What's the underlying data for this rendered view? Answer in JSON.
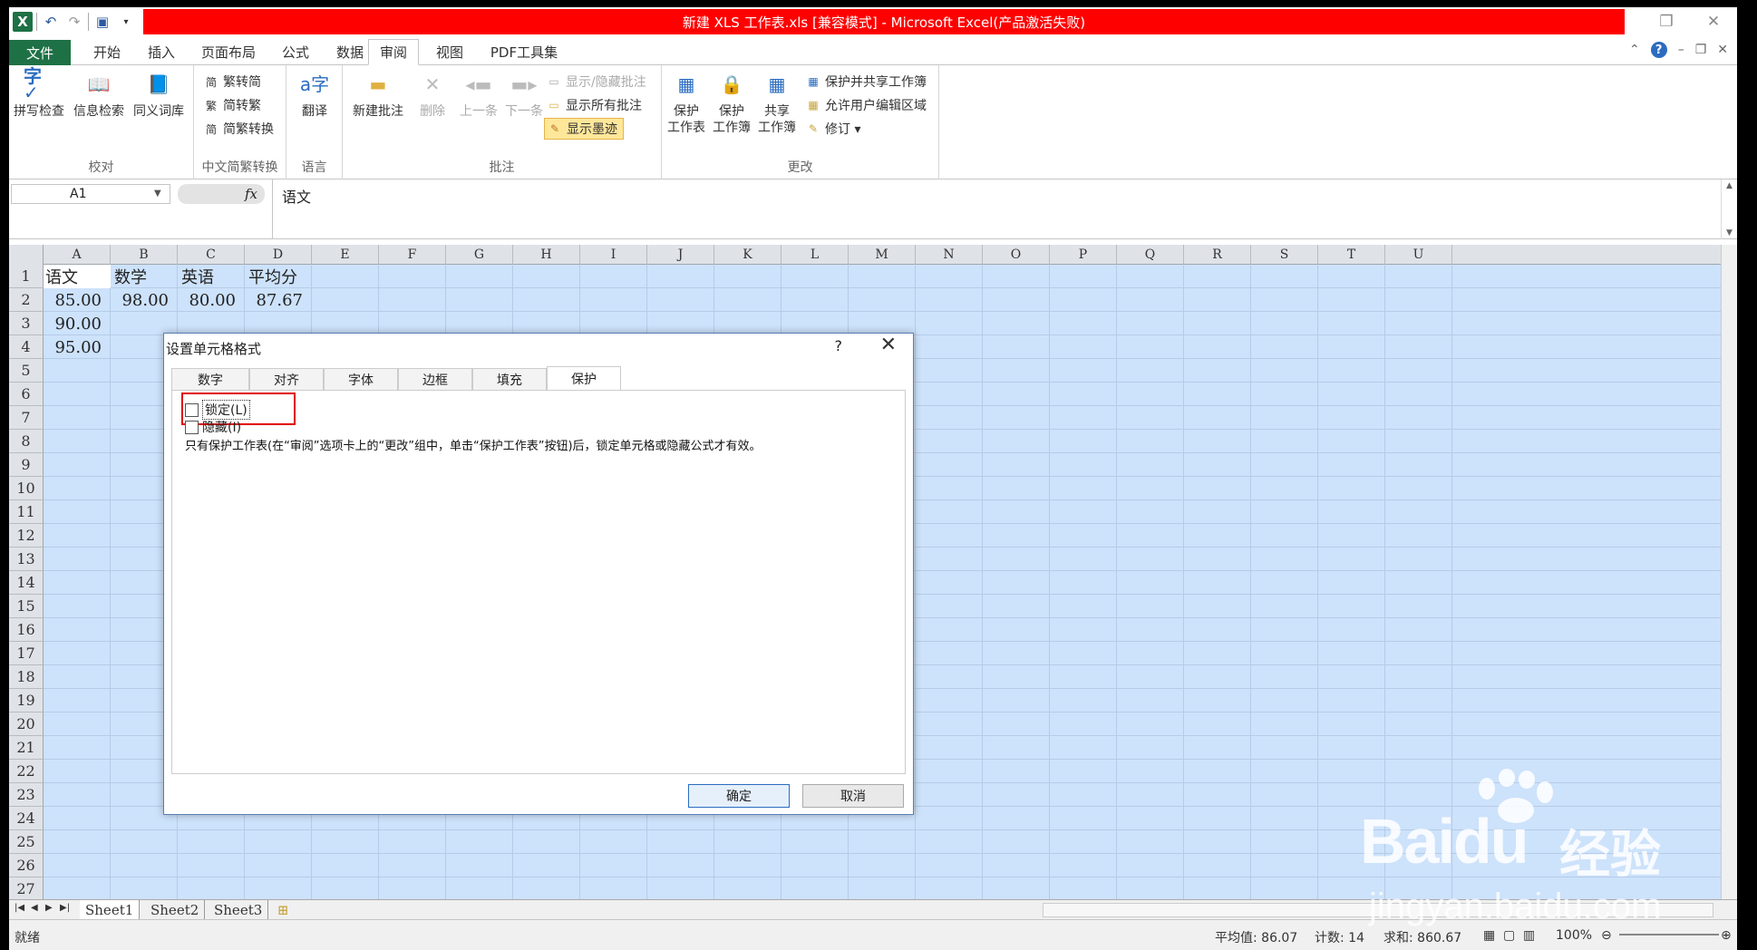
{
  "window": {
    "title": "新建 XLS 工作表.xls  [兼容模式] - Microsoft Excel(产品激活失败)",
    "title_bg": "#ff0000"
  },
  "menu": {
    "file": "文件",
    "tabs": [
      "开始",
      "插入",
      "页面布局",
      "公式",
      "数据",
      "审阅",
      "视图",
      "PDF工具集"
    ],
    "active": "审阅"
  },
  "ribbon": {
    "proofing": {
      "label": "校对",
      "buttons": [
        "拼写检查",
        "信息检索",
        "同义词库"
      ]
    },
    "chinese_conversion": {
      "label": "中文简繁转换",
      "buttons": [
        "繁转简",
        "简转繁",
        "简繁转换"
      ]
    },
    "language": {
      "label": "语言",
      "buttons": [
        "翻译"
      ]
    },
    "comments": {
      "label": "批注",
      "new": "新建批注",
      "delete": "删除",
      "prev": "上一条",
      "next": "下一条",
      "show_hide": "显示/隐藏批注",
      "show_all": "显示所有批注",
      "show_ink": "显示墨迹"
    },
    "changes": {
      "label": "更改",
      "protect_sheet": [
        "保护",
        "工作表"
      ],
      "protect_workbook": [
        "保护",
        "工作簿"
      ],
      "share_workbook": [
        "共享",
        "工作簿"
      ],
      "protect_share": "保护并共享工作簿",
      "allow_edit": "允许用户编辑区域",
      "track": "修订 ▾"
    }
  },
  "formula_bar": {
    "name_box": "A1",
    "fx": "fx",
    "value": "语文"
  },
  "grid": {
    "columns": [
      "A",
      "B",
      "C",
      "D",
      "E",
      "F",
      "G",
      "H",
      "I",
      "J",
      "K",
      "L",
      "M",
      "N",
      "O",
      "P",
      "Q",
      "R",
      "S",
      "T",
      "U"
    ],
    "rows": [
      "1",
      "2",
      "3",
      "4",
      "5",
      "6",
      "7",
      "8",
      "9",
      "10",
      "11",
      "12",
      "13",
      "14",
      "15",
      "16",
      "17",
      "18",
      "19",
      "20",
      "21",
      "22",
      "23",
      "24",
      "25",
      "26",
      "27"
    ],
    "cells": {
      "A1": "语文",
      "B1": "数学",
      "C1": "英语",
      "D1": "平均分",
      "A2": "85.00",
      "B2": "98.00",
      "C2": "80.00",
      "D2": "87.67",
      "A3": "90.00",
      "A4": "95.00"
    }
  },
  "sheets": [
    "Sheet1",
    "Sheet2",
    "Sheet3"
  ],
  "status": {
    "ready": "就绪",
    "average": "平均值: 86.07",
    "count": "计数: 14",
    "sum": "求和: 860.67",
    "zoom": "100%"
  },
  "dialog": {
    "title": "设置单元格格式",
    "help": "?",
    "tabs": [
      "数字",
      "对齐",
      "字体",
      "边框",
      "填充",
      "保护"
    ],
    "active_tab": "保护",
    "locked": "锁定(L)",
    "hidden": "隐藏(I)",
    "note": "只有保护工作表(在“审阅”选项卡上的“更改”组中，单击“保护工作表”按钮)后，锁定单元格或隐藏公式才有效。",
    "ok": "确定",
    "cancel": "取消"
  },
  "watermark": {
    "brand": "Baidu",
    "brand_cn": "经验",
    "url": "jingyan.baidu.com"
  }
}
